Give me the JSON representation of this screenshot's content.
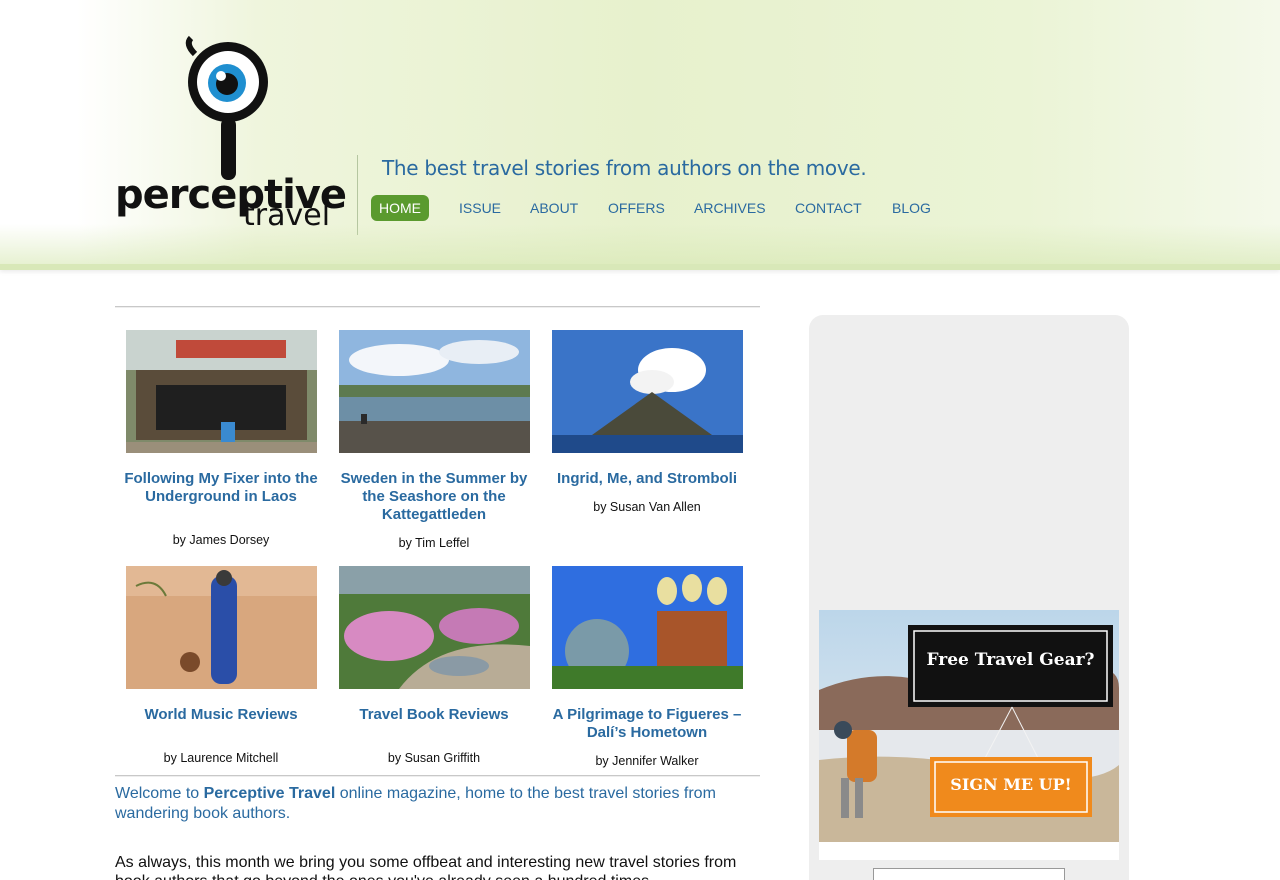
{
  "brand": {
    "logo_text_main": "perceptive",
    "logo_text_sub": "travel",
    "tagline": "The best travel stories from authors on the move."
  },
  "nav": [
    {
      "label": "HOME",
      "active": true
    },
    {
      "label": "ISSUE",
      "active": false
    },
    {
      "label": "ABOUT",
      "active": false
    },
    {
      "label": "OFFERS",
      "active": false
    },
    {
      "label": "ARCHIVES",
      "active": false
    },
    {
      "label": "CONTACT",
      "active": false
    },
    {
      "label": "BLOG",
      "active": false
    }
  ],
  "stories": [
    {
      "title": "Following My Fixer into the Underground in Laos",
      "byline": "by James Dorsey",
      "image": "laos-underground-photo"
    },
    {
      "title": "Sweden in the Summer by the Seashore on the Kattegattleden",
      "byline": "by Tim Leffel",
      "image": "sweden-seashore-photo"
    },
    {
      "title": "Ingrid, Me, and Stromboli",
      "byline": "by Susan Van Allen",
      "image": "stromboli-volcano-photo"
    },
    {
      "title": "World Music Reviews",
      "byline": "by Laurence Mitchell",
      "image": "desert-musician-photo"
    },
    {
      "title": "Travel Book Reviews",
      "byline": "by Susan Griffith",
      "image": "river-flowers-photo"
    },
    {
      "title": "A Pilgrimage to Figueres – Dalí’s Hometown",
      "byline": "by Jennifer Walker",
      "image": "dali-museum-photo"
    }
  ],
  "welcome": {
    "prefix": "Welcome to ",
    "brand": "Perceptive Travel",
    "suffix": " online magazine, home to the best travel stories from wandering book authors."
  },
  "intro": "As always, this month we bring you some offbeat and interesting new travel stories from book authors that go beyond the ones you've already seen a hundred times.",
  "ad": {
    "headline": "Free Travel Gear?",
    "cta": "SIGN ME UP!"
  },
  "colors": {
    "link": "#2a6aa0",
    "nav_active": "#5a9a2e",
    "ad_cta": "#f08a1c"
  }
}
